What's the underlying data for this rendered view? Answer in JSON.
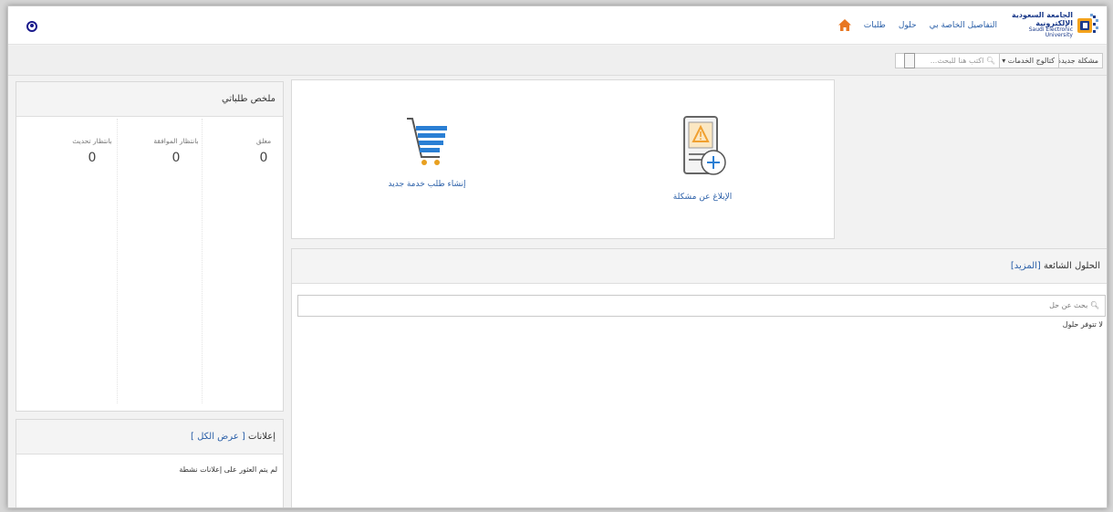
{
  "header": {
    "logo_ar": "الجامعة السعودية الإلكترونية",
    "logo_en": "Saudi Electronic University",
    "nav": [
      "طلبات",
      "حلول",
      "التفاصيل الخاصة بي"
    ]
  },
  "toolbar": {
    "new_issue": "مشكلة جديدة",
    "catalog": "كتالوج الخدمات",
    "search_placeholder": "اكتب هنا للبحث..."
  },
  "summary": {
    "title": "ملخص طلباتي",
    "stats": [
      {
        "label": "معلق",
        "value": "0"
      },
      {
        "label": "بانتظار الموافقة",
        "value": "0"
      },
      {
        "label": "بانتظار تحديث",
        "value": "0"
      }
    ]
  },
  "announcements": {
    "title": "إعلانات",
    "view_all": "[ عرض الكل ]",
    "empty": "لم يتم العثور على إعلانات نشطة"
  },
  "actions": {
    "report": "الإبلاغ عن مشكلة",
    "new_request": "إنشاء طلب خدمة جديد"
  },
  "solutions": {
    "title": "الحلول الشائعة",
    "more": "[المزيد]",
    "search_placeholder": "بحث عن حل",
    "empty": "لا تتوفر حلول"
  },
  "colors": {
    "link": "#2a5fa8",
    "logo_blue": "#1b3a8a",
    "home_orange": "#e87722",
    "cart_blue": "#2a7fd4",
    "warning_orange": "#f0a030"
  }
}
